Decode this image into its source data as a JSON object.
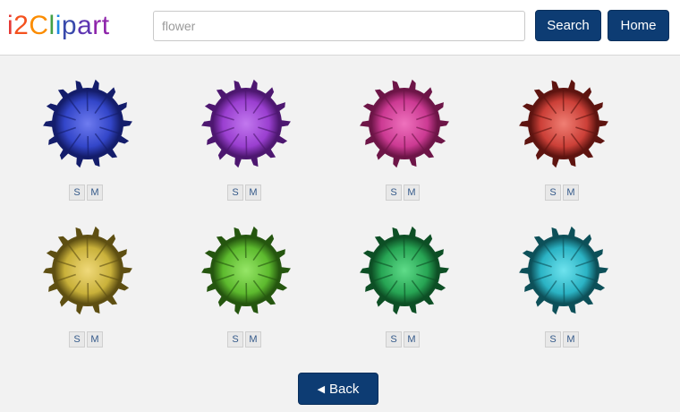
{
  "header": {
    "logo_letters": [
      {
        "ch": "i",
        "color": "#e53935"
      },
      {
        "ch": "2",
        "color": "#f4511e"
      },
      {
        "ch": "C",
        "color": "#fb8c00"
      },
      {
        "ch": "l",
        "color": "#43a047"
      },
      {
        "ch": "i",
        "color": "#1e88e5"
      },
      {
        "ch": "p",
        "color": "#3949ab"
      },
      {
        "ch": "a",
        "color": "#5e35b1"
      },
      {
        "ch": "r",
        "color": "#8e24aa"
      },
      {
        "ch": "t",
        "color": "#8e24aa"
      }
    ],
    "search": {
      "placeholder": "flower",
      "value": ""
    },
    "search_label": "Search",
    "home_label": "Home"
  },
  "results": [
    {
      "color": "blue",
      "main": "#3346c9",
      "light": "#6f7cf0",
      "dark": "#141d6b",
      "s": "S",
      "m": "M"
    },
    {
      "color": "purple",
      "main": "#9a3fd0",
      "light": "#c278ef",
      "dark": "#4d1770",
      "s": "S",
      "m": "M"
    },
    {
      "color": "pink",
      "main": "#cc3a93",
      "light": "#ef72bd",
      "dark": "#6d1547",
      "s": "S",
      "m": "M"
    },
    {
      "color": "red",
      "main": "#cc4038",
      "light": "#f07f74",
      "dark": "#5e1410",
      "s": "S",
      "m": "M"
    },
    {
      "color": "yellow",
      "main": "#c9b13a",
      "light": "#f0d97a",
      "dark": "#5e4f12",
      "s": "S",
      "m": "M"
    },
    {
      "color": "lime",
      "main": "#5dba2e",
      "light": "#96e667",
      "dark": "#25560f",
      "s": "S",
      "m": "M"
    },
    {
      "color": "green",
      "main": "#27a554",
      "light": "#5fdc89",
      "dark": "#0d4f25",
      "s": "S",
      "m": "M"
    },
    {
      "color": "cyan",
      "main": "#2bb3c4",
      "light": "#6ee3ee",
      "dark": "#0d5059",
      "s": "S",
      "m": "M"
    }
  ],
  "footer": {
    "back_label": "Back",
    "back_icon": "left-triangle-icon"
  }
}
